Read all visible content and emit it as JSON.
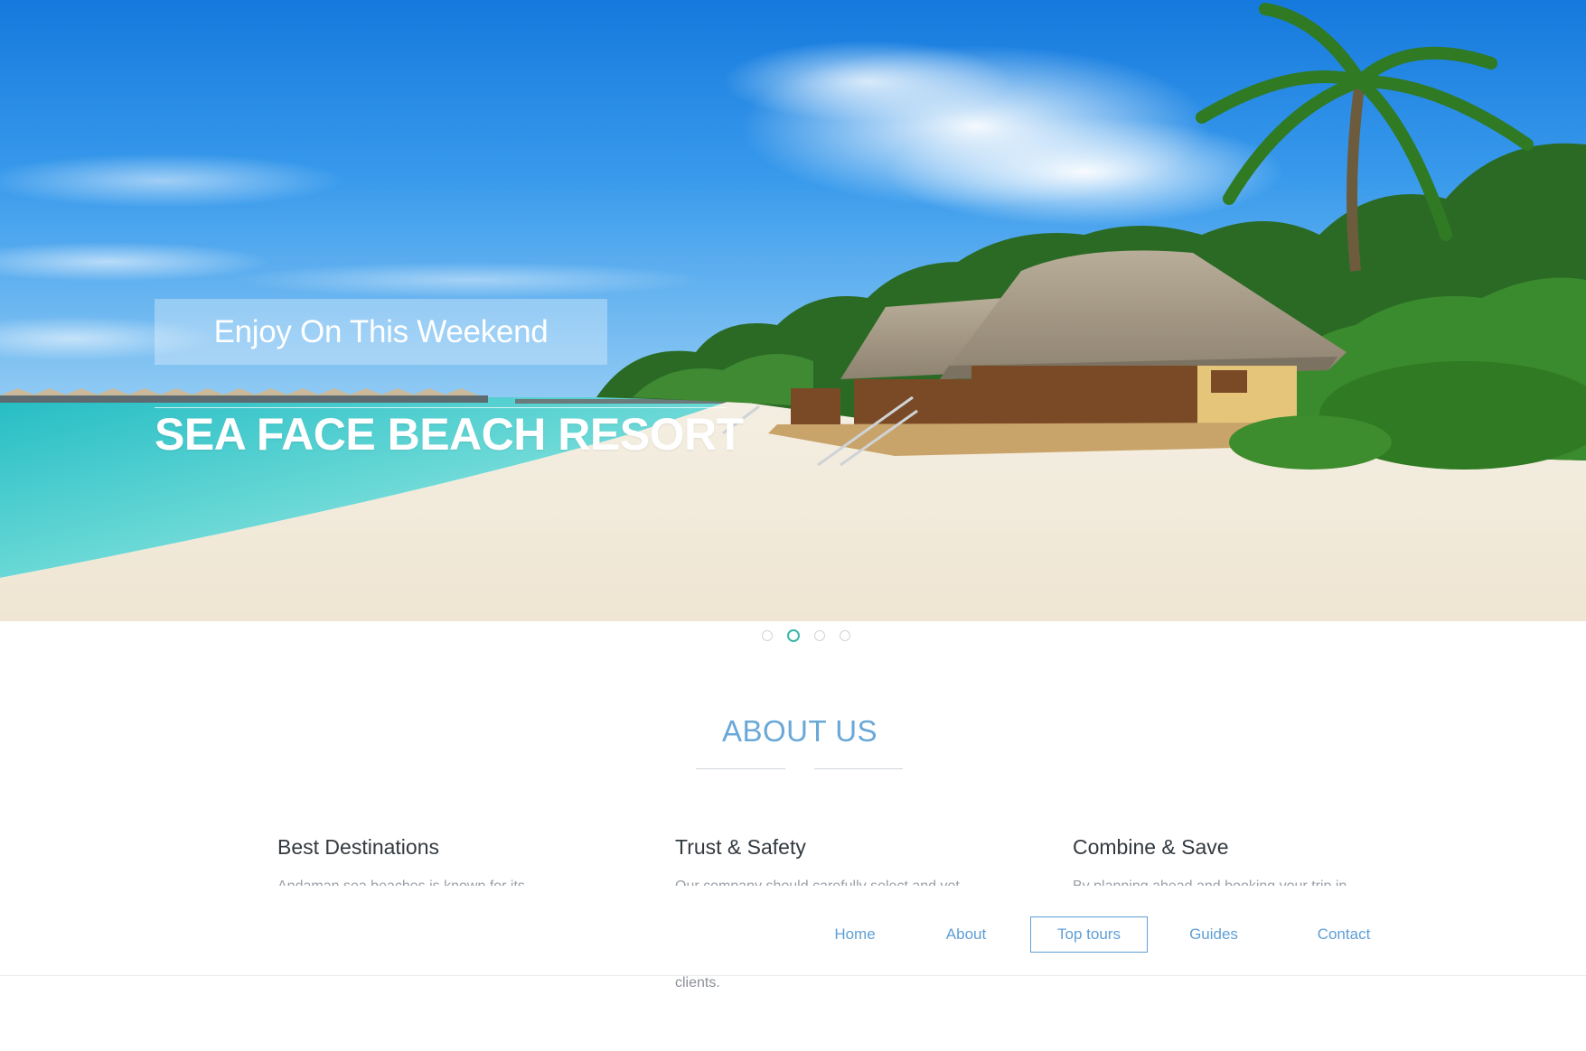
{
  "hero": {
    "tagline": "Enjoy On This Weekend",
    "title": "SEA FACE BEACH RESORT",
    "image": "beach-resort-photo"
  },
  "slider": {
    "slide_count": 4,
    "active_index": 1,
    "active_color": "#3ab8a6"
  },
  "about": {
    "heading": "ABOUT US",
    "features": [
      {
        "title": "Best Destinations",
        "text": "Andaman sea beaches is known for its"
      },
      {
        "title": "Trust & Safety",
        "text": "Our company should carefully select and vet"
      },
      {
        "title": "Combine & Save",
        "text": "By planning ahead and booking your trip in"
      }
    ],
    "trailing_text": "clients."
  },
  "nav": {
    "items": [
      {
        "label": "Home"
      },
      {
        "label": "About"
      },
      {
        "label": "Top tours"
      },
      {
        "label": "Guides"
      },
      {
        "label": "Contact"
      }
    ],
    "active": "Top tours",
    "link_color": "#5e9fd6"
  }
}
